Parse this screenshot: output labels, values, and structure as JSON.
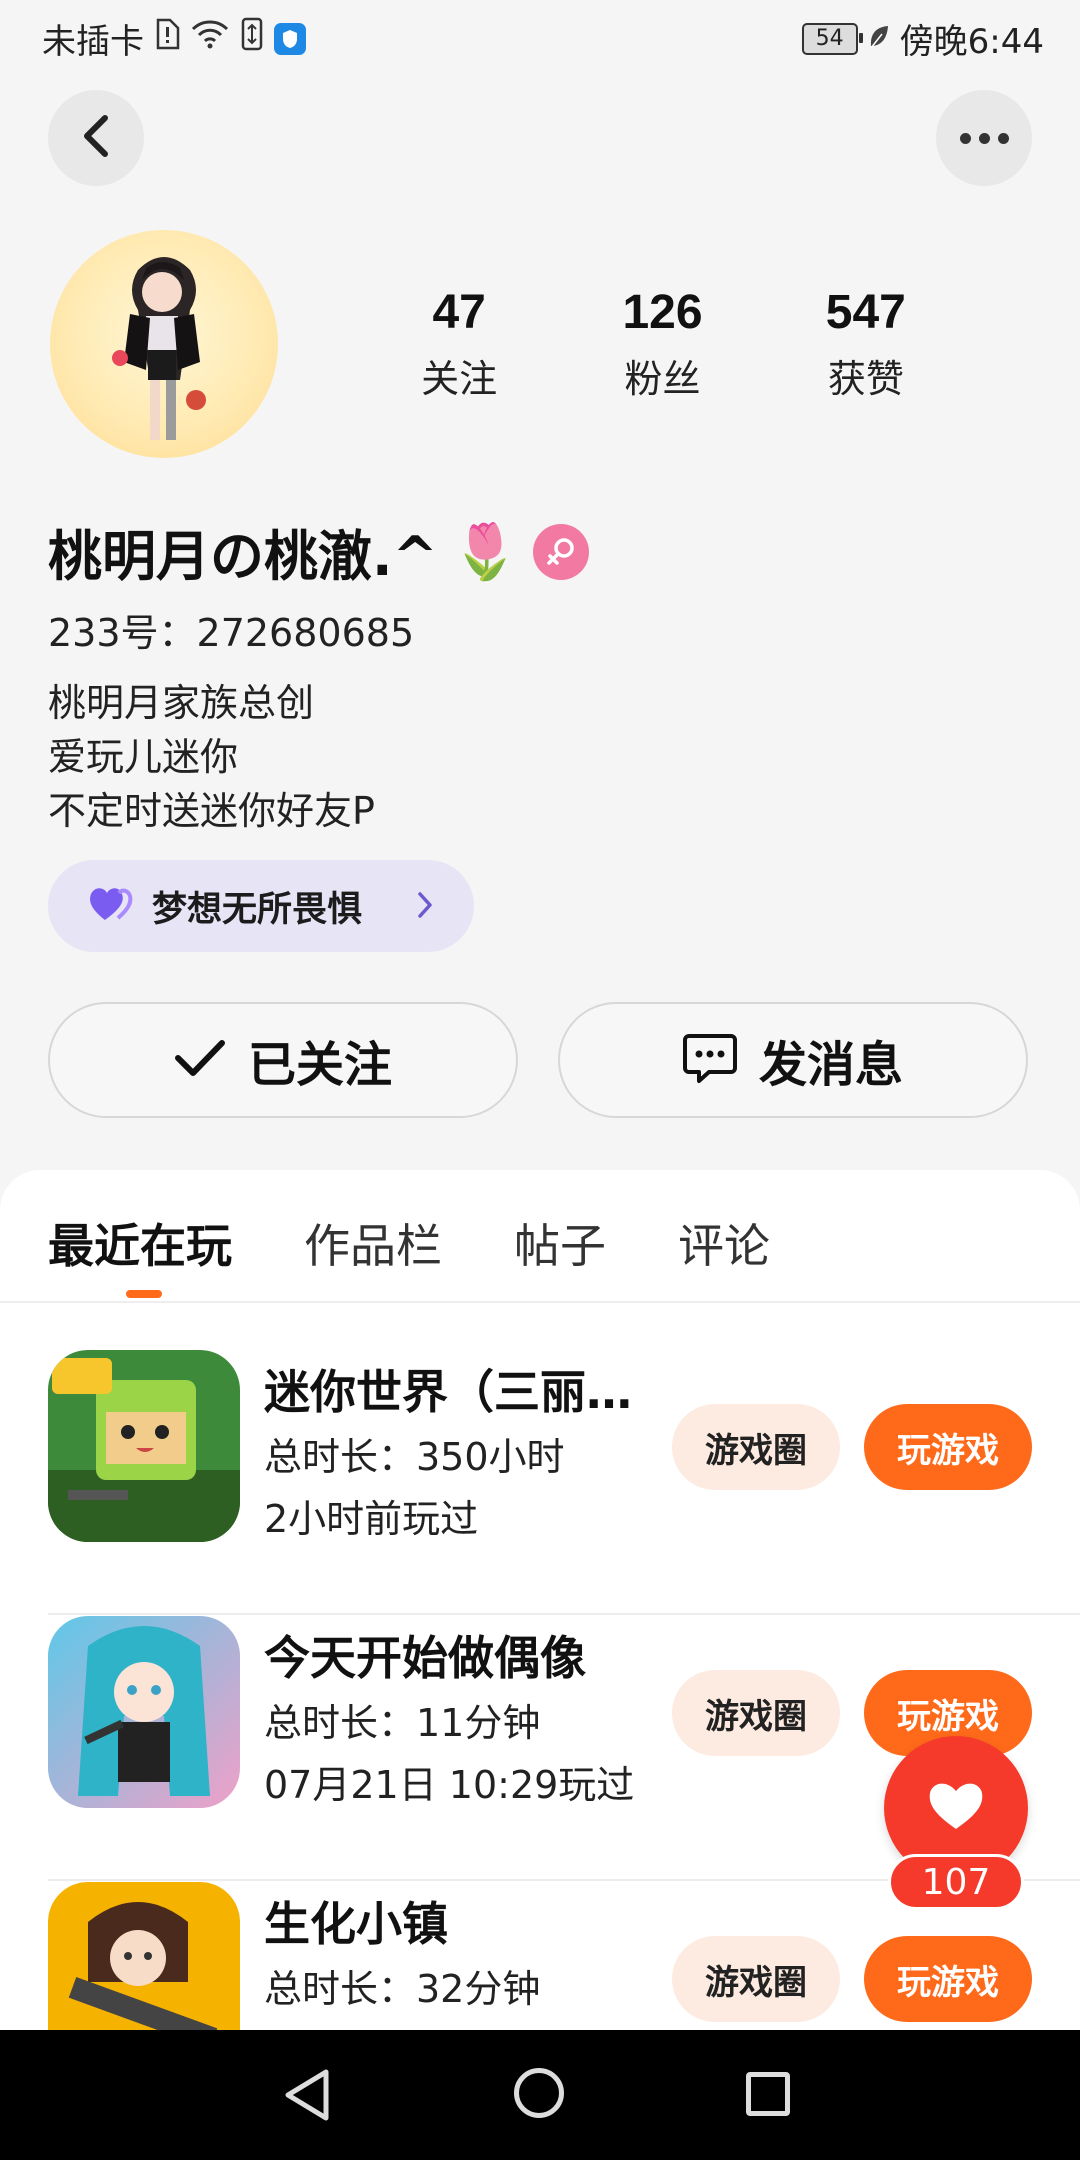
{
  "status_bar": {
    "carrier": "未插卡",
    "battery": "54",
    "time": "傍晚6:44"
  },
  "profile": {
    "stats": [
      {
        "value": "47",
        "label": "关注"
      },
      {
        "value": "126",
        "label": "粉丝"
      },
      {
        "value": "547",
        "label": "获赞"
      }
    ],
    "nickname": "桃明月の桃澈.^",
    "nickname_emoji": "🌷",
    "uid": "233号：272680685",
    "bio_lines": [
      "桃明月家族总创",
      "爱玩儿迷你",
      "不定时送迷你好友P"
    ],
    "pill_label": "梦想无所畏惧",
    "follow_label": "已关注",
    "message_label": "发消息"
  },
  "tabs": [
    {
      "label": "最近在玩",
      "active": true
    },
    {
      "label": "作品栏",
      "active": false
    },
    {
      "label": "帖子",
      "active": false
    },
    {
      "label": "评论",
      "active": false
    }
  ],
  "games": [
    {
      "title": "迷你世界（三丽…",
      "duration": "总时长：350小时",
      "last_played": "2小时前玩过",
      "circle_label": "游戏圈",
      "play_label": "玩游戏"
    },
    {
      "title": "今天开始做偶像",
      "duration": "总时长：11分钟",
      "last_played": "07月21日 10:29玩过",
      "circle_label": "游戏圈",
      "play_label": "玩游戏"
    },
    {
      "title": "生化小镇",
      "duration": "总时长：32分钟",
      "last_played": "",
      "circle_label": "游戏圈",
      "play_label": "玩游戏"
    }
  ],
  "like_fab": {
    "count": "107"
  },
  "colors": {
    "accent_orange": "#ff6a1a",
    "like_red": "#f53a2b",
    "pill_purple": "#e7e4f6",
    "gender_pink": "#f27aa2"
  }
}
